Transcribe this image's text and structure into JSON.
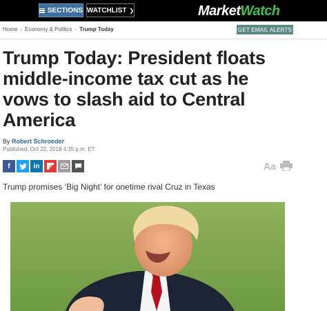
{
  "topbar": {
    "sections_label": "SECTIONS",
    "watchlist_label": "WATCHLIST",
    "logo_part1": "Market",
    "logo_part2": "Watch"
  },
  "breadcrumb": {
    "items": [
      "Home",
      "Economy & Politics",
      "Trump Today"
    ],
    "separator": "›"
  },
  "alerts_button": "GET EMAIL ALERTS",
  "article": {
    "headline": "Trump Today: President floats middle-income tax cut as he vows to slash aid to Central America",
    "by_prefix": "By",
    "author": "Robert Schroeder",
    "published": "Published: Oct 22, 2018 4:35 p.m. ET",
    "subheadline": "Trump promises ‘Big Night’ for onetime rival Cruz in Texas"
  },
  "tools": {
    "font_size_label": "Aa"
  },
  "colors": {
    "topbar": "#000000",
    "sections_button": "#3a6fa0",
    "logo_accent": "#3ec24b",
    "alerts_button": "#5d8a86",
    "author_link": "#2b6a9b"
  },
  "icons": [
    "facebook-icon",
    "twitter-icon",
    "linkedin-icon",
    "flipboard-icon",
    "email-icon",
    "comment-icon",
    "print-icon"
  ]
}
